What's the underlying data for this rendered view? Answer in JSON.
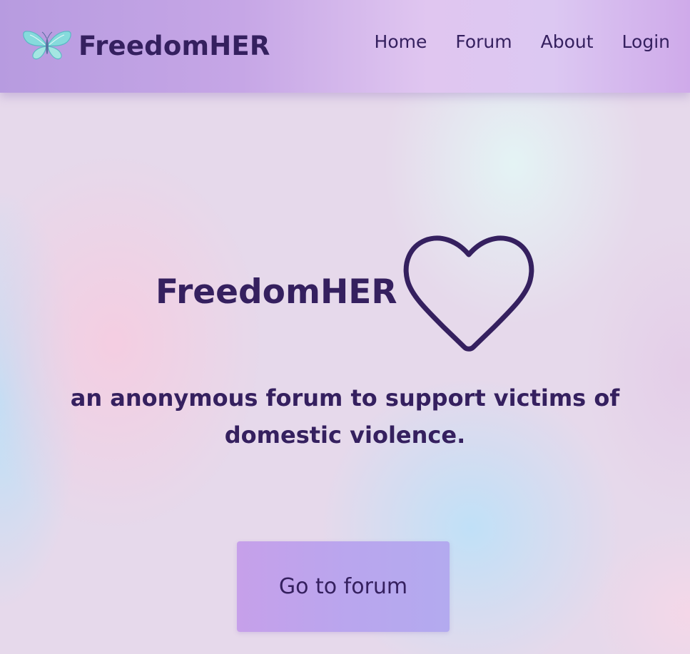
{
  "header": {
    "brand_name": "FreedomHER",
    "brand_logo_icon": "butterfly-icon",
    "nav": [
      {
        "label": "Home"
      },
      {
        "label": "Forum"
      },
      {
        "label": "About"
      },
      {
        "label": "Login"
      }
    ]
  },
  "hero": {
    "title": "FreedomHER",
    "title_icon": "heart-outline-icon",
    "subtitle": "an anonymous forum to support victims of domestic violence.",
    "cta_label": "Go to forum"
  },
  "colors": {
    "text": "#35205f",
    "navbar_start": "#b79be0",
    "navbar_end": "#cfaaea",
    "button": "#c6a0ea",
    "butterfly": "#7fd3d6"
  }
}
